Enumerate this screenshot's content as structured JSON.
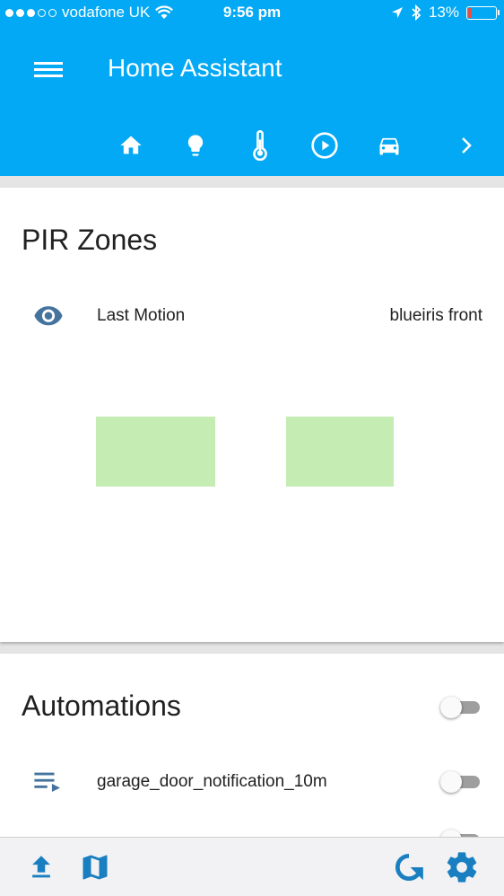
{
  "status_bar": {
    "carrier": "vodafone UK",
    "time": "9:56 pm",
    "battery": "13%"
  },
  "header": {
    "title": "Home Assistant",
    "tabs": [
      {
        "icon": "home-icon"
      },
      {
        "icon": "lightbulb-icon"
      },
      {
        "icon": "thermometer-icon"
      },
      {
        "icon": "play-circle-icon"
      },
      {
        "icon": "car-icon"
      }
    ],
    "next_icon": "chevron-right-icon",
    "color": "#03a9f4"
  },
  "pir_card": {
    "title": "PIR Zones",
    "row": {
      "icon": "eye-icon",
      "label": "Last Motion",
      "value": "blueiris front"
    },
    "zone_color": "#c4ecb3"
  },
  "automations_card": {
    "title": "Automations",
    "items": [
      {
        "icon": "playlist-play-icon",
        "label": "garage_door_notification_10m"
      }
    ]
  },
  "bottom_bar": {
    "buttons": [
      "upload-icon",
      "map-icon",
      "refresh-icon",
      "settings-icon"
    ],
    "icon_color": "#1a7fc1"
  }
}
